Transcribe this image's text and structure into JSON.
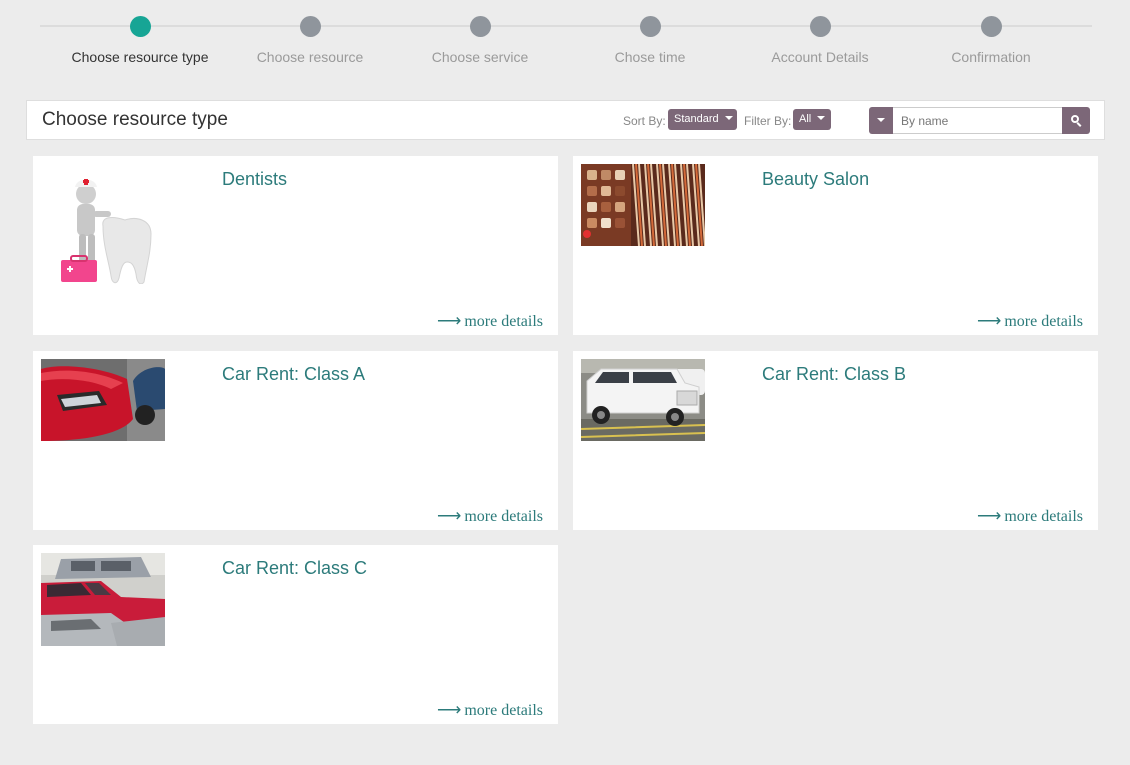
{
  "steps": [
    {
      "label": "Choose resource type",
      "active": true
    },
    {
      "label": "Choose resource",
      "active": false
    },
    {
      "label": "Choose service",
      "active": false
    },
    {
      "label": "Chose time",
      "active": false
    },
    {
      "label": "Account Details",
      "active": false
    },
    {
      "label": "Confirmation",
      "active": false
    }
  ],
  "header": {
    "title": "Choose resource type",
    "sort_label": "Sort By:",
    "sort_value": "Standard",
    "filter_label": "Filter By:",
    "filter_value": "All",
    "search_placeholder": "By name"
  },
  "cards": [
    {
      "title": "Dentists",
      "link_text": "more details",
      "image": "dentist-figure-image"
    },
    {
      "title": "Beauty Salon",
      "link_text": "more details",
      "image": "beauty-salon-image"
    },
    {
      "title": "Car Rent: Class A",
      "link_text": "more details",
      "image": "red-car-image"
    },
    {
      "title": "Car Rent: Class B",
      "link_text": "more details",
      "image": "white-jeep-image"
    },
    {
      "title": "Car Rent: Class C",
      "link_text": "more details",
      "image": "parking-lot-image"
    }
  ],
  "colors": {
    "accent": "#17a595",
    "link": "#2c7b7b",
    "button": "#7c6778",
    "inactive_step": "#8f959c",
    "background": "#ececec"
  }
}
